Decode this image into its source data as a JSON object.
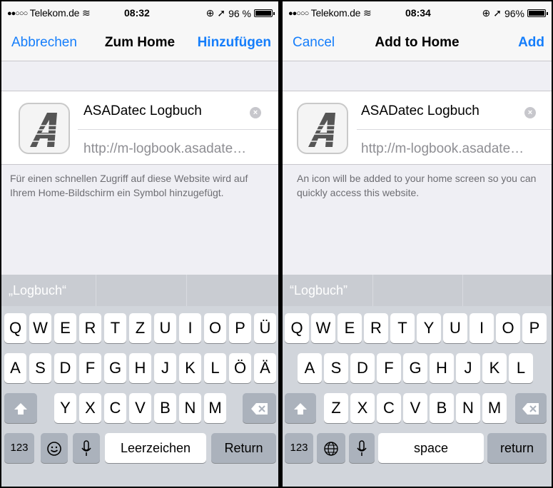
{
  "left": {
    "status": {
      "carrier": "Telekom.de",
      "time": "08:32",
      "battery": "96 %",
      "battery_level": 0.96
    },
    "nav": {
      "cancel": "Abbrechen",
      "title": "Zum Home",
      "add": "Hinzufügen"
    },
    "card": {
      "name": "ASADatec Logbuch",
      "url": "http://m-logbook.asadate…"
    },
    "help": "Für einen schnellen Zugriff auf diese Website wird auf Ihrem Home-Bildschirm ein Symbol hinzugefügt.",
    "suggestion": "„Logbuch“",
    "keys": {
      "row1": [
        "Q",
        "W",
        "E",
        "R",
        "T",
        "Z",
        "U",
        "I",
        "O",
        "P",
        "Ü"
      ],
      "row2": [
        "A",
        "S",
        "D",
        "F",
        "G",
        "H",
        "J",
        "K",
        "L",
        "Ö",
        "Ä"
      ],
      "row3": [
        "Y",
        "X",
        "C",
        "V",
        "B",
        "N",
        "M"
      ],
      "numbers": "123",
      "space": "Leerzeichen",
      "return": "Return"
    }
  },
  "right": {
    "status": {
      "carrier": "Telekom.de",
      "time": "08:34",
      "battery": "96%",
      "battery_level": 0.96
    },
    "nav": {
      "cancel": "Cancel",
      "title": "Add to Home",
      "add": "Add"
    },
    "card": {
      "name": "ASADatec Logbuch",
      "url": "http://m-logbook.asadate…"
    },
    "help": "An icon will be added to your home screen so you can quickly access this website.",
    "suggestion": "“Logbuch”",
    "keys": {
      "row1": [
        "Q",
        "W",
        "E",
        "R",
        "T",
        "Y",
        "U",
        "I",
        "O",
        "P"
      ],
      "row2": [
        "A",
        "S",
        "D",
        "F",
        "G",
        "H",
        "J",
        "K",
        "L"
      ],
      "row3": [
        "Z",
        "X",
        "C",
        "V",
        "B",
        "N",
        "M"
      ],
      "numbers": "123",
      "space": "space",
      "return": "return"
    }
  },
  "colors": {
    "accent": "#157efb",
    "keyboard_bg": "#d1d5db",
    "dark_key": "#abb2bc"
  },
  "icons": [
    "signal-dots-icon",
    "wifi-icon",
    "location-icon",
    "lock-rotation-icon",
    "battery-icon",
    "clear-icon",
    "shift-icon",
    "delete-icon",
    "emoji-icon",
    "globe-icon",
    "mic-icon",
    "app-logo-icon"
  ]
}
